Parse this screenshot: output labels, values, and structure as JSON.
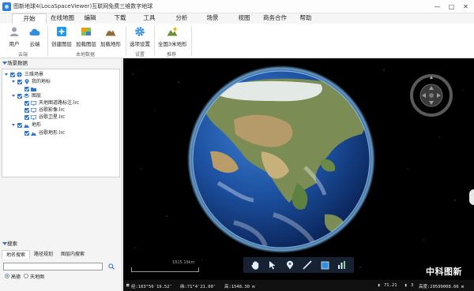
{
  "window": {
    "title": "图新地球4(LocaSpaceViewer)互联网免费三维数字地球",
    "minimize": "—",
    "maximize": "□",
    "close": "✕"
  },
  "menu": {
    "tabs": [
      "开始",
      "在线地图",
      "编辑",
      "下载",
      "工具",
      "分析",
      "场景",
      "视图",
      "商务合作",
      "帮助"
    ],
    "active": "开始"
  },
  "ribbon": {
    "buttons": {
      "user": "用户",
      "cloud": "云端",
      "new_layer": "创建图层",
      "load_layer": "加载图层",
      "load_terrain": "加载地形",
      "options": "选项设置",
      "national_terrain": "全国3米地形"
    },
    "groups": {
      "cloud": "云端",
      "local": "本地数据",
      "settings": "设置",
      "recommend": "推荐"
    }
  },
  "left_panel": {
    "scene_header": "场景数据",
    "tree": {
      "root": "三维场景",
      "my_places": "我的地标",
      "layers": "图层",
      "layer_items": [
        "天地图道路标注.lrc",
        "谷歌影像.lrc",
        "谷歌卫星.lrc"
      ],
      "terrain": "地形",
      "terrain_items": [
        "谷歌地形.lrc"
      ]
    },
    "search_header": "搜索",
    "search_tabs": [
      "地名搜索",
      "路径规划",
      "图层内搜索"
    ],
    "search_input": "",
    "source_options": [
      "高德",
      "天地图"
    ],
    "source_selected": "高德"
  },
  "map": {
    "scale": "1815.19km",
    "status": {
      "lon": "经:103°56′19.52″",
      "lat": "纬:71°4′21.00″",
      "elev": "高:1548.30 m",
      "fps": "71.21",
      "level": "3",
      "cam_height": "高度:20599008.66 m"
    },
    "watermark": "中科图新"
  },
  "colors": {
    "accent": "#2f76c9",
    "map_bg": "#000000",
    "panel_bg": "#f4f4f4"
  }
}
